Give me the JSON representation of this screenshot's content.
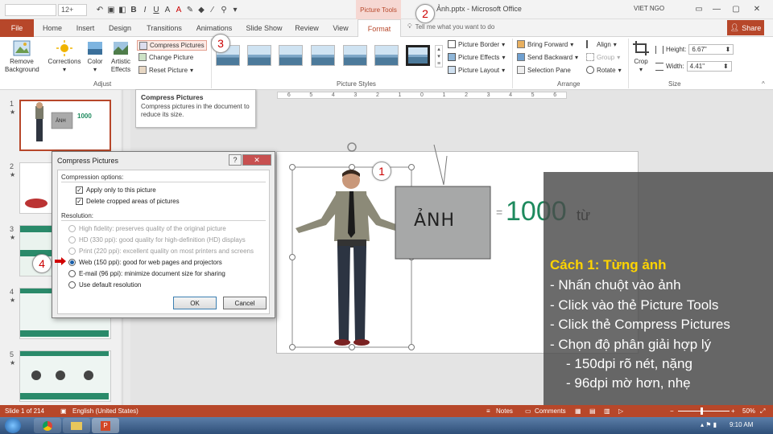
{
  "app": {
    "window_title": "2. Ảnh.pptx - Microsoft Office",
    "context_tab_group": "Picture Tools",
    "user": "VIET NGO",
    "font_size": "12+"
  },
  "tabs": [
    "File",
    "Home",
    "Insert",
    "Design",
    "Transitions",
    "Animations",
    "Slide Show",
    "Review",
    "View",
    "Format"
  ],
  "tell_me": "Tell me what you want to do",
  "share": "Share",
  "ribbon": {
    "remove_background": "Remove Background",
    "corrections": "Corrections",
    "color": "Color",
    "artistic_effects": "Artistic Effects",
    "compress_pictures": "Compress Pictures",
    "change_picture": "Change Picture",
    "reset_picture": "Reset Picture",
    "group_adjust": "Adjust",
    "group_picture_styles": "Picture Styles",
    "picture_border": "Picture Border",
    "picture_effects": "Picture Effects",
    "picture_layout": "Picture Layout",
    "bring_forward": "Bring Forward",
    "send_backward": "Send Backward",
    "selection_pane": "Selection Pane",
    "align": "Align",
    "group": "Group",
    "rotate": "Rotate",
    "group_arrange": "Arrange",
    "crop": "Crop",
    "height_label": "Height:",
    "height_value": "6.67\"",
    "width_label": "Width:",
    "width_value": "4.41\"",
    "group_size": "Size"
  },
  "tooltip": {
    "title": "Compress Pictures",
    "body": "Compress pictures in the document to reduce its size."
  },
  "slides": {
    "numbers": [
      "1",
      "2",
      "3",
      "4",
      "5"
    ],
    "thumb1_text": "1000",
    "thumb1_sign": "ẢNH"
  },
  "ruler": [
    "6",
    "5",
    "4",
    "3",
    "2",
    "1",
    "0",
    "1",
    "2",
    "3",
    "4",
    "5",
    "6"
  ],
  "slide_content": {
    "sign_text": "ẢNH",
    "equals": "=",
    "number": "1000",
    "word": "từ"
  },
  "dialog": {
    "title": "Compress Pictures",
    "help": "?",
    "close": "✕",
    "compression_options": "Compression options:",
    "apply_only": "Apply only to this picture",
    "delete_cropped": "Delete cropped areas of pictures",
    "resolution": "Resolution:",
    "high_fidelity": "High fidelity: preserves quality of the original picture",
    "hd": "HD (330 ppi): good quality for high-definition (HD) displays",
    "print": "Print (220 ppi): excellent quality on most printers and screens",
    "web": "Web (150 ppi): good for web pages and projectors",
    "email": "E-mail (96 ppi): minimize document size for sharing",
    "default_res": "Use default resolution",
    "ok": "OK",
    "cancel": "Cancel"
  },
  "overlay": {
    "heading": "Cách 1: Từng ảnh",
    "step1": "-  Nhấn chuột vào ảnh",
    "step2": "-  Click vào thẻ Picture Tools",
    "step3": "-  Click thẻ Compress Pictures",
    "step4": "-  Chọn độ phân giải hợp lý",
    "sub1": "-  150dpi  rõ nét, nặng",
    "sub2": "- 96dpi mờ hơn, nhẹ"
  },
  "callouts": [
    "1",
    "2",
    "3",
    "4"
  ],
  "status": {
    "slide": "Slide 1 of 214",
    "language": "English (United States)",
    "notes": "Notes",
    "comments": "Comments",
    "zoom": "50%"
  },
  "taskbar": {
    "time": "9:10 AM"
  },
  "colors": {
    "accent": "#b7472a",
    "green_text": "#1e8a5e",
    "overlay_heading": "#ffd400"
  }
}
